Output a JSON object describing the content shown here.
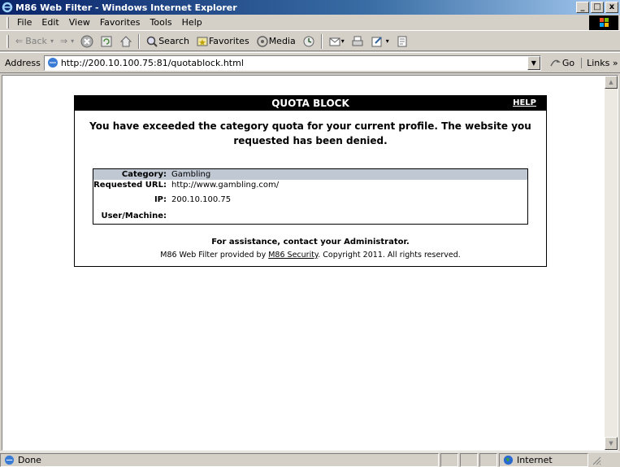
{
  "window": {
    "title": "M86 Web Filter - Windows Internet Explorer",
    "buttons": {
      "minimize": "_",
      "maximize": "□",
      "close": "x"
    }
  },
  "menubar": {
    "items": [
      "File",
      "Edit",
      "View",
      "Favorites",
      "Tools",
      "Help"
    ]
  },
  "toolbar": {
    "back": "Back",
    "search": "Search",
    "favorites": "Favorites",
    "media": "Media"
  },
  "addressbar": {
    "label": "Address",
    "url": "http://200.10.100.75:81/quotablock.html",
    "go": "Go",
    "links": "Links »"
  },
  "page": {
    "header_title": "QUOTA BLOCK",
    "help_link": "HELP",
    "message": "You have exceeded the category quota for your current profile. The website you requested has been denied.",
    "details": [
      {
        "label": "Category:",
        "value": "Gambling"
      },
      {
        "label": "Requested URL:",
        "value": "http://www.gambling.com/"
      },
      {
        "label": "IP:",
        "value": "200.10.100.75"
      },
      {
        "label": "User/Machine:",
        "value": ""
      }
    ],
    "assistance": "For assistance, contact your Administrator.",
    "footer_prefix": "M86 Web Filter provided by ",
    "footer_link": "M86 Security",
    "footer_suffix": ". Copyright 2011. All rights reserved."
  },
  "statusbar": {
    "status": "Done",
    "zone": "Internet"
  },
  "colors": {
    "title_bar": "#0a246a",
    "block_header": "#000000",
    "details_highlight": "#c0c8d4"
  }
}
